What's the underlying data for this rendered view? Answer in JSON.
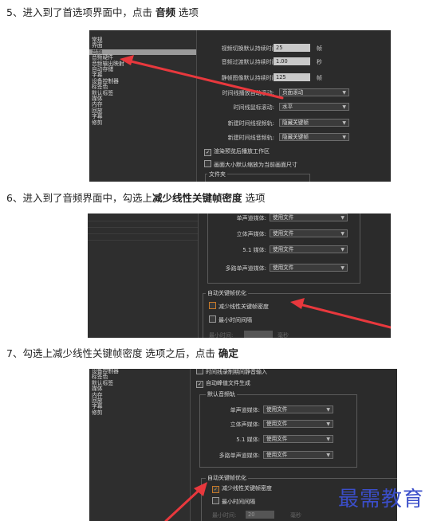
{
  "steps": {
    "s5_prefix": "5、进入到了首选项界面中，点击 ",
    "s5_bold": "音频",
    "s5_suffix": " 选项",
    "s6_prefix": "6、进入到了音频界面中，勾选上",
    "s6_bold": "减少线性关键帧密度",
    "s6_suffix": " 选项",
    "s7_prefix": "7、勾选上减少线性关键帧密度 选项之后，点击 ",
    "s7_bold": "确定"
  },
  "shot1": {
    "sidebar": [
      "常规",
      "界面",
      "音频",
      "音频硬件",
      "音频输出映射",
      "自动存储",
      "字幕",
      "设备控制器",
      "标签色",
      "默认标签",
      "媒体",
      "内存",
      "回放",
      "字幕",
      "修剪"
    ],
    "selected_index": 2,
    "rows": {
      "video_default_label": "视频切换默认持续时间:",
      "video_default_value": "25",
      "video_default_unit": "帧",
      "audio_default_label": "音频过渡默认持续时间:",
      "audio_default_value": "1.00",
      "audio_default_unit": "秒",
      "still_default_label": "静帧图像默认持续时间:",
      "still_default_value": "125",
      "still_default_unit": "帧",
      "timeline_scroll_label": "时间线播放自动滚动:",
      "timeline_scroll_value": "页面滚动",
      "timeline_mouse_label": "时间线鼠标滚动:",
      "timeline_mouse_value": "水平",
      "new_video_label": "新建时间线视频轨:",
      "new_video_value": "隐藏关键帧",
      "new_audio_label": "新建时间线音频轨:",
      "new_audio_value": "隐藏关键帧",
      "render_preview_label": "渲染预览后播放工作区",
      "scale_default_label": "画面大小默认缩放为当前画面尺寸",
      "bins_label": "文件夹"
    }
  },
  "shot2": {
    "mono_label": "单声道媒体:",
    "mono_value": "使用文件",
    "stereo_label": "立体声媒体:",
    "stereo_value": "使用文件",
    "s51_label": "5.1 媒体:",
    "s51_value": "使用文件",
    "multi_label": "多路单声道媒体:",
    "multi_value": "使用文件",
    "group_title": "自动关键帧优化",
    "reduce_label": "减少线性关键帧密度",
    "min_interval_label": "最小时间间隔",
    "min_time_label": "最小时间:",
    "ms_label": "毫秒"
  },
  "shot3": {
    "sidebar": [
      "设备控制器",
      "标签色",
      "默认标签",
      "媒体",
      "内存",
      "回放",
      "字幕",
      "修剪"
    ],
    "top_check1": "时间线录制期间静音输入",
    "top_check2": "自动峰值文件生成",
    "default_tracks_title": "默认音频轨",
    "mono_label": "单声道媒体:",
    "mono_value": "使用文件",
    "stereo_label": "立体声媒体:",
    "stereo_value": "使用文件",
    "s51_label": "5.1 媒体:",
    "s51_value": "使用文件",
    "multi_label": "多路单声道媒体:",
    "multi_value": "使用文件",
    "group_title": "自动关键帧优化",
    "reduce_label": "减少线性关键帧密度",
    "min_interval_label": "最小时间间隔",
    "min_time_label": "最小时间:",
    "min_time_value": "20",
    "ms_label": "毫秒",
    "reduce_checkmark": "✓"
  },
  "watermark": "最需教育",
  "colors": {
    "arrow": "#e8383d",
    "watermark": "#3b4ec9"
  }
}
